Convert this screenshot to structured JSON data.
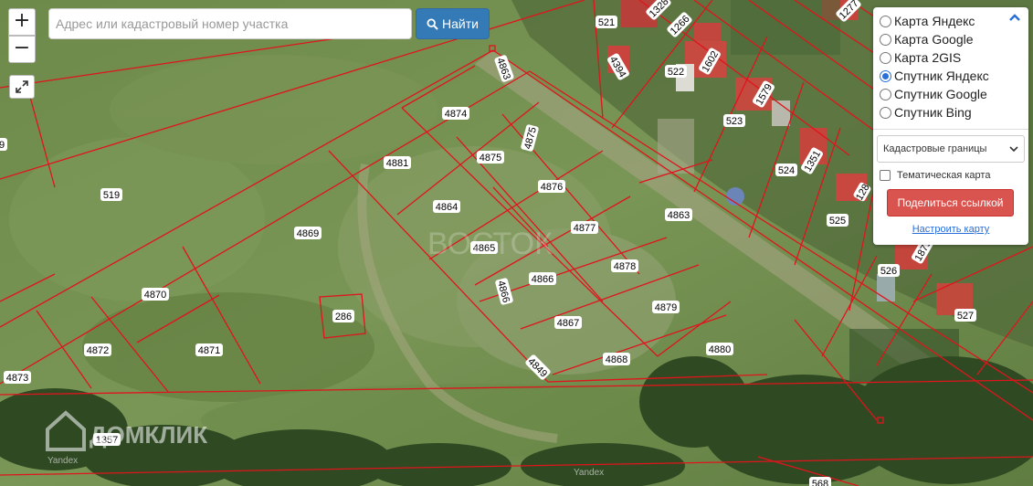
{
  "search": {
    "placeholder": "Адрес или кадастровый номер участка",
    "button_label": "Найти",
    "button_icon": "search-icon"
  },
  "zoom": {
    "in_label": "+",
    "out_label": "−"
  },
  "layers": {
    "options": [
      {
        "label": "Карта Яндекс",
        "selected": false
      },
      {
        "label": "Карта Google",
        "selected": false
      },
      {
        "label": "Карта 2GIS",
        "selected": false
      },
      {
        "label": "Спутник Яндекс",
        "selected": true
      },
      {
        "label": "Спутник Google",
        "selected": false
      },
      {
        "label": "Спутник Bing",
        "selected": false
      }
    ],
    "boundary_select": "Кадастровые границы",
    "thematic_label": "Тематическая карта",
    "thematic_checked": false,
    "share_label": "Поделиться ссылкой",
    "configure_label": "Настроить карту"
  },
  "watermarks": {
    "brand": "ДОМКЛИК",
    "center": "ВОСТОК",
    "provider_left": "Yandex",
    "provider_bottom": "Yandex"
  },
  "plots": {
    "p521": "521",
    "p1328": "1328",
    "p1266": "1266",
    "p1277": "1277",
    "p4863a": "4863",
    "p4394": "4394",
    "p522": "522",
    "p1602": "1602",
    "p4874": "4874",
    "p1579": "1579",
    "p523": "523",
    "p4875v": "4875",
    "p4881": "4881",
    "p4875": "4875",
    "p4876": "4876",
    "p524": "524",
    "p1351": "1351",
    "p519": "519",
    "p4864": "4864",
    "p4863b": "4863",
    "p525": "525",
    "p4877": "4877",
    "p4869": "4869",
    "p4865": "4865",
    "p4878": "4878",
    "p4866": "4866",
    "p526": "526",
    "p4870": "4870",
    "p286": "286",
    "p4879": "4879",
    "p4867": "4867",
    "p527": "527",
    "p4872": "4872",
    "p4871": "4871",
    "p4880": "4880",
    "p4868": "4868",
    "p4849": "4849",
    "p4873": "4873",
    "p1357": "1357",
    "p568": "568",
    "p9": "9",
    "p1879": "1879",
    "p128": "128"
  },
  "colors": {
    "boundary": "#e0141c",
    "accent_blue": "#337ab7",
    "share_red": "#d9534f"
  }
}
